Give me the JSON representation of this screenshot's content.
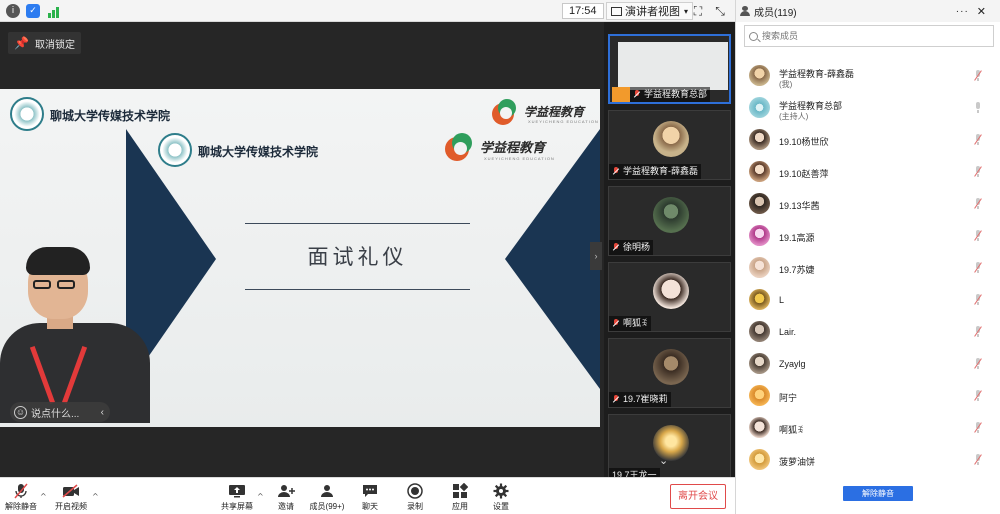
{
  "topbar": {
    "timer": "17:54",
    "view_label": "演讲者视图",
    "colors": {
      "shield": "#2d7cf0",
      "signal": "#2bb24c"
    }
  },
  "main": {
    "unlock_label": "取消锁定",
    "slide": {
      "title": "面试礼仪",
      "university_top": "聊城大学传媒技术学院",
      "university_mid": "聊城大学传媒技术学院",
      "brand_top": "学益程教育",
      "brand_mid": "学益程教育",
      "brand_sub_top": "XUEYICHENG EDUCATION",
      "brand_sub_mid": "XUEYICHENG EDUCATION"
    },
    "chat_placeholder": "说点什么..."
  },
  "thumbnails": [
    {
      "name": "学益程教育总部",
      "host": true
    },
    {
      "name": "学益程教育-薛鑫磊",
      "host": false
    },
    {
      "name": "徐明杨",
      "host": false
    },
    {
      "name": "啊狐ꉂ",
      "host": false
    },
    {
      "name": "19.7崔晓莉",
      "host": false
    },
    {
      "name": "19.7王龙一",
      "host": false
    }
  ],
  "toolbar": {
    "unmute": "解除静音",
    "start_video": "开启视频",
    "share_screen": "共享屏幕",
    "invite": "邀请",
    "members": "成员(99+)",
    "chat": "聊天",
    "record": "录制",
    "apps": "应用",
    "settings": "设置",
    "leave": "离开会议"
  },
  "panel": {
    "title": "成员(119)",
    "search_placeholder": "搜索成员",
    "unmute_all": "解除静音",
    "members": [
      {
        "name": "学益程教育-薛鑫磊",
        "role": "(我)",
        "muted": true
      },
      {
        "name": "学益程教育总部",
        "role": "(主持人)",
        "muted": false
      },
      {
        "name": "19.10杨世欣",
        "role": "",
        "muted": true
      },
      {
        "name": "19.10赵善萍",
        "role": "",
        "muted": true
      },
      {
        "name": "19.13华茜",
        "role": "",
        "muted": true
      },
      {
        "name": "19.1高源",
        "role": "",
        "muted": true
      },
      {
        "name": "19.7苏婕",
        "role": "",
        "muted": true
      },
      {
        "name": "L",
        "role": "",
        "muted": true
      },
      {
        "name": "Lair.",
        "role": "",
        "muted": true
      },
      {
        "name": "Zyaylg",
        "role": "",
        "muted": true
      },
      {
        "name": "阿宁",
        "role": "",
        "muted": true
      },
      {
        "name": "啊狐ꉂ",
        "role": "",
        "muted": true
      },
      {
        "name": "菠萝油饼",
        "role": "",
        "muted": true
      }
    ]
  }
}
